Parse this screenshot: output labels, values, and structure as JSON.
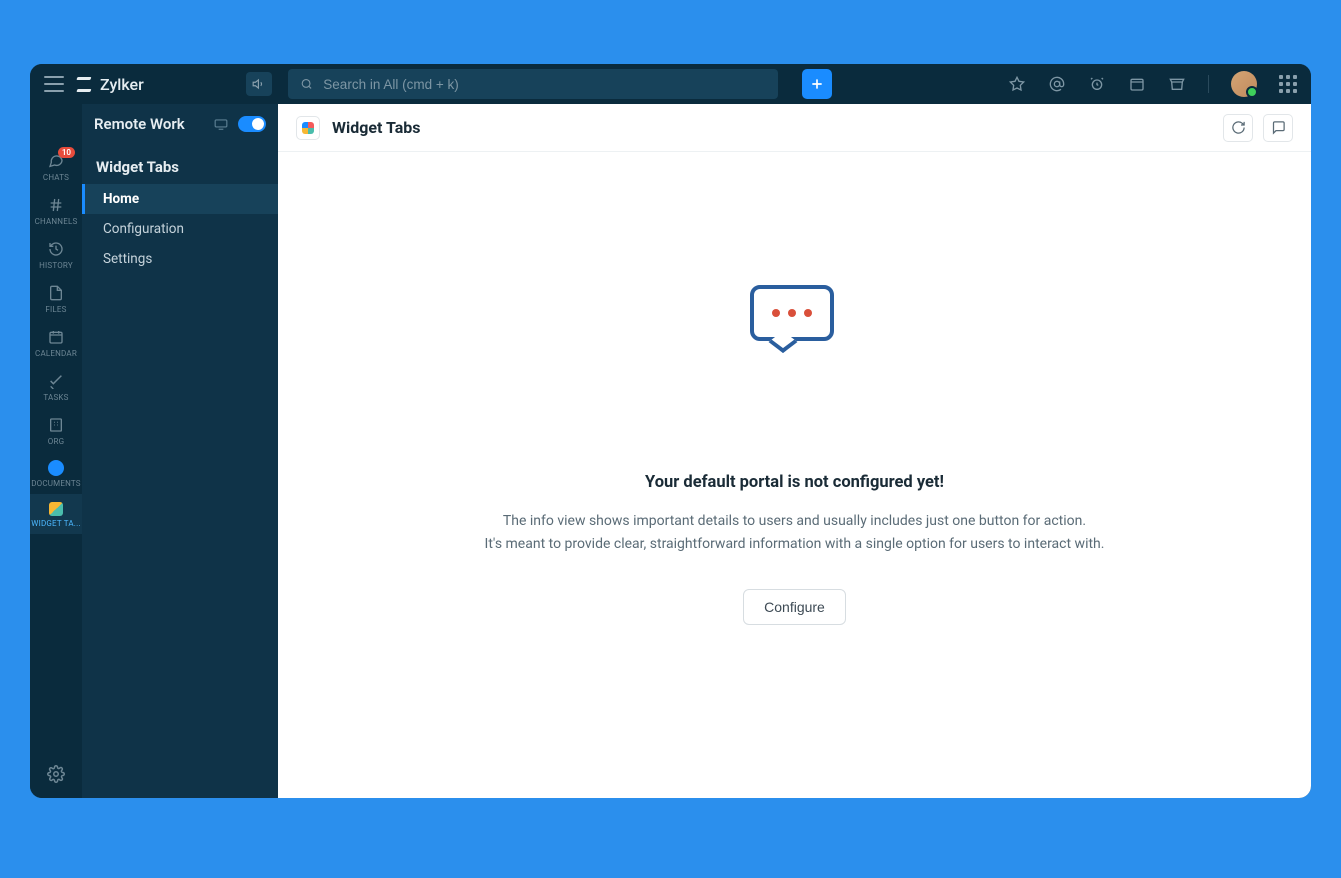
{
  "brand": {
    "name": "Zylker"
  },
  "search": {
    "placeholder": "Search in All (cmd + k)"
  },
  "workspace": {
    "name": "Remote Work"
  },
  "rail": {
    "items": [
      {
        "label": "CHATS",
        "badge": "10"
      },
      {
        "label": "CHANNELS"
      },
      {
        "label": "HISTORY"
      },
      {
        "label": "FILES"
      },
      {
        "label": "CALENDAR"
      },
      {
        "label": "TASKS"
      },
      {
        "label": "ORG"
      },
      {
        "label": "DOCUMENTS"
      },
      {
        "label": "WIDGET TA..."
      }
    ]
  },
  "sidebar": {
    "title": "Widget Tabs",
    "items": [
      {
        "label": "Home"
      },
      {
        "label": "Configuration"
      },
      {
        "label": "Settings"
      }
    ]
  },
  "main": {
    "title": "Widget Tabs",
    "empty": {
      "heading": "Your default portal is not configured yet!",
      "line1": "The info view shows important details to users and usually includes just one button for action.",
      "line2": "It's meant to provide clear, straightforward information with a single option for users to interact with.",
      "button": "Configure"
    }
  }
}
